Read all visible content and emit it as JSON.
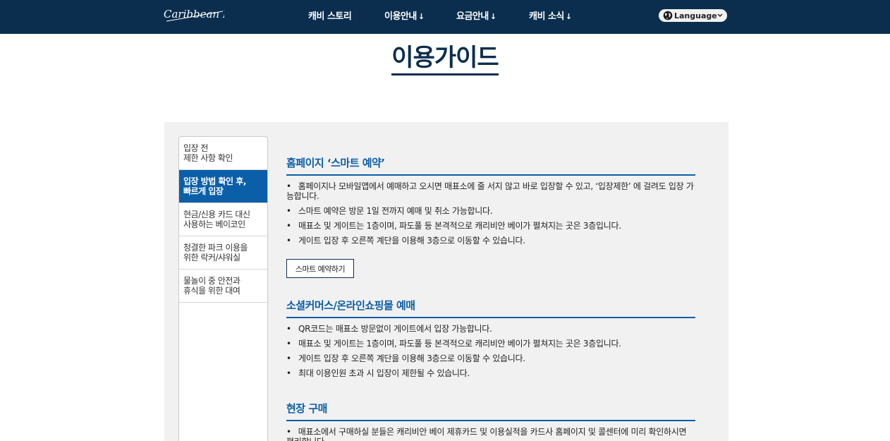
{
  "header": {
    "logo_text": "Caribbean Bay",
    "nav": [
      {
        "label": "캐비 스토리",
        "has_arrow": false
      },
      {
        "label": "이용안내",
        "has_arrow": true
      },
      {
        "label": "요금안내",
        "has_arrow": true
      },
      {
        "label": "캐비 소식",
        "has_arrow": true
      }
    ],
    "arrow_glyph": "↓",
    "language": {
      "selected": "Language",
      "icon": "globe-icon"
    }
  },
  "page": {
    "title": "이용가이드"
  },
  "sidebar": {
    "items": [
      {
        "line1": "입장 전",
        "line2": "제한 사항 확인",
        "active": false
      },
      {
        "line1": "입장 방법 확인 후,",
        "line2": "빠르게 입장",
        "active": true
      },
      {
        "line1": "현금/신용 카드 대신",
        "line2": "사용하는 베이코인",
        "active": false
      },
      {
        "line1": "청결한 파크 이용을",
        "line2": "위한 락커/샤워실",
        "active": false
      },
      {
        "line1": "물놀이 중 안전과",
        "line2": "휴식을 위한 대여",
        "active": false
      }
    ]
  },
  "sections": [
    {
      "title": "홈페이지 ‘스마트 예약’",
      "bullets": [
        "홈페이지나 모바일앱에서 예매하고 오시면 매표소에 줄 서지 않고 바로 입장할 수 있고, ‘입장제한’ 에 걸려도 입장 가능합니다.",
        "스마트 예약은 방문 1일 전까지 예매 및 취소 가능합니다.",
        "매표소 및 게이트는 1층이며, 파도풀 등 본격적으로 캐리비안 베이가 펼쳐지는 곳은 3층입니다.",
        "게이트 입장 후 오른쪽 계단을 이용해 3층으로 이동할 수 있습니다."
      ],
      "button": "스마트 예약하기"
    },
    {
      "title": "소셜커머스/온라인쇼핑몰 예매",
      "bullets": [
        "QR코드는 매표소 방문없이 게이트에서 입장 가능합니다.",
        "매표소 및 게이트는 1층이며, 파도풀 등 본격적으로 캐리비안 베이가 펼쳐지는 곳은 3층입니다.",
        "게이트 입장 후 오른쪽 계단을 이용해 3층으로 이동할 수 있습니다.",
        "최대 이용인원 초과 시 입장이 제한될 수 있습니다."
      ]
    },
    {
      "title": "현장 구매",
      "bullets": [
        "매표소에서 구매하실 분들은 캐리비안 베이 제휴카드 및 이용실적을 카드사 홈페이지 및 콜센터에 미리 확인하시면 편리합니다."
      ]
    }
  ],
  "colors": {
    "header_bg": "#0b2e4f",
    "accent": "#0b5ea8",
    "panel_bg": "#f1f1f1"
  }
}
